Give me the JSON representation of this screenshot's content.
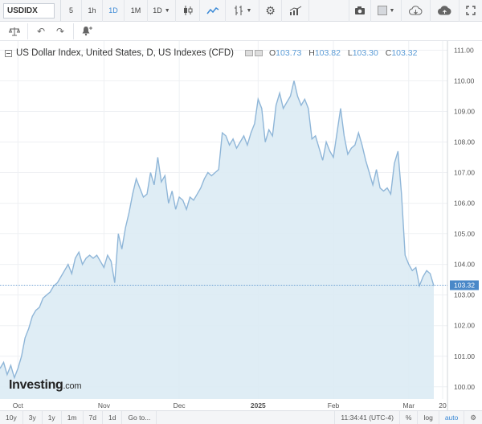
{
  "toolbar": {
    "symbol": "USDIDX",
    "intervals": [
      {
        "label": "5",
        "active": false
      },
      {
        "label": "1h",
        "active": false
      },
      {
        "label": "1D",
        "active": true
      },
      {
        "label": "1M",
        "active": false
      }
    ],
    "interval_select": "1D",
    "icons": [
      "candlestick-icon",
      "area-chart-icon",
      "indicators-icon",
      "settings-icon",
      "compare-icon",
      "camera-icon",
      "color-picker-icon",
      "cloud-download-icon",
      "cloud-upload-icon",
      "fullscreen-icon"
    ]
  },
  "toolbar2": {
    "icons": [
      "balance-icon",
      "undo-icon",
      "redo-icon",
      "alert-icon"
    ]
  },
  "legend": {
    "title": "US Dollar Index, United States, D, US Indexes (CFD)",
    "open_label": "O",
    "open": "103.73",
    "high_label": "H",
    "high": "103.82",
    "low_label": "L",
    "low": "103.30",
    "close_label": "C",
    "close": "103.32"
  },
  "logo": {
    "text": "Investing",
    "suffix": ".com"
  },
  "chart_data": {
    "type": "area",
    "title": "US Dollar Index, United States, D, US Indexes (CFD)",
    "ylim": [
      99.6,
      111.3
    ],
    "y_ticks": [
      "100.00",
      "101.00",
      "102.00",
      "103.00",
      "104.00",
      "105.00",
      "106.00",
      "107.00",
      "108.00",
      "109.00",
      "110.00",
      "111.00"
    ],
    "x_ticks": [
      "Oct",
      "Nov",
      "Dec",
      "2025",
      "Feb",
      "Mar",
      "20"
    ],
    "last_price": "103.32",
    "last_value": 103.32,
    "colors": {
      "line": "#8fb6d8",
      "fill": "#dcebf4",
      "last_price_bg": "#4a88c8",
      "grid": "#eef0f3"
    },
    "values": [
      100.6,
      100.8,
      100.4,
      100.7,
      100.3,
      100.6,
      101.0,
      101.6,
      101.9,
      102.3,
      102.5,
      102.6,
      102.9,
      103.0,
      103.1,
      103.3,
      103.4,
      103.6,
      103.8,
      104.0,
      103.7,
      104.2,
      104.4,
      104.0,
      104.2,
      104.3,
      104.2,
      104.3,
      104.1,
      103.9,
      104.3,
      104.1,
      103.4,
      105.0,
      104.5,
      105.2,
      105.7,
      106.3,
      106.8,
      106.5,
      106.2,
      106.3,
      107.0,
      106.6,
      107.5,
      106.7,
      106.9,
      106.0,
      106.4,
      105.8,
      106.2,
      106.1,
      105.8,
      106.2,
      106.1,
      106.3,
      106.5,
      106.8,
      107.0,
      106.9,
      107.0,
      107.1,
      108.3,
      108.2,
      107.9,
      108.1,
      107.8,
      108.0,
      108.2,
      107.9,
      108.3,
      108.6,
      109.4,
      109.1,
      108.0,
      108.4,
      108.2,
      109.2,
      109.6,
      109.1,
      109.3,
      109.5,
      110.0,
      109.5,
      109.2,
      109.4,
      109.1,
      108.1,
      108.2,
      107.8,
      107.4,
      108.0,
      107.7,
      107.5,
      108.3,
      109.1,
      108.2,
      107.6,
      107.8,
      107.9,
      108.3,
      107.9,
      107.4,
      107.0,
      106.6,
      107.1,
      106.5,
      106.4,
      106.5,
      106.3,
      107.3,
      107.7,
      106.3,
      104.3,
      104.0,
      103.8,
      103.9,
      103.3,
      103.6,
      103.8,
      103.7,
      103.3
    ]
  },
  "bottombar": {
    "ranges": [
      "10y",
      "3y",
      "1y",
      "1m",
      "7d",
      "1d"
    ],
    "goto": "Go to...",
    "time": "11:34:41 (UTC-4)",
    "percent": "%",
    "log": "log",
    "auto": "auto"
  }
}
